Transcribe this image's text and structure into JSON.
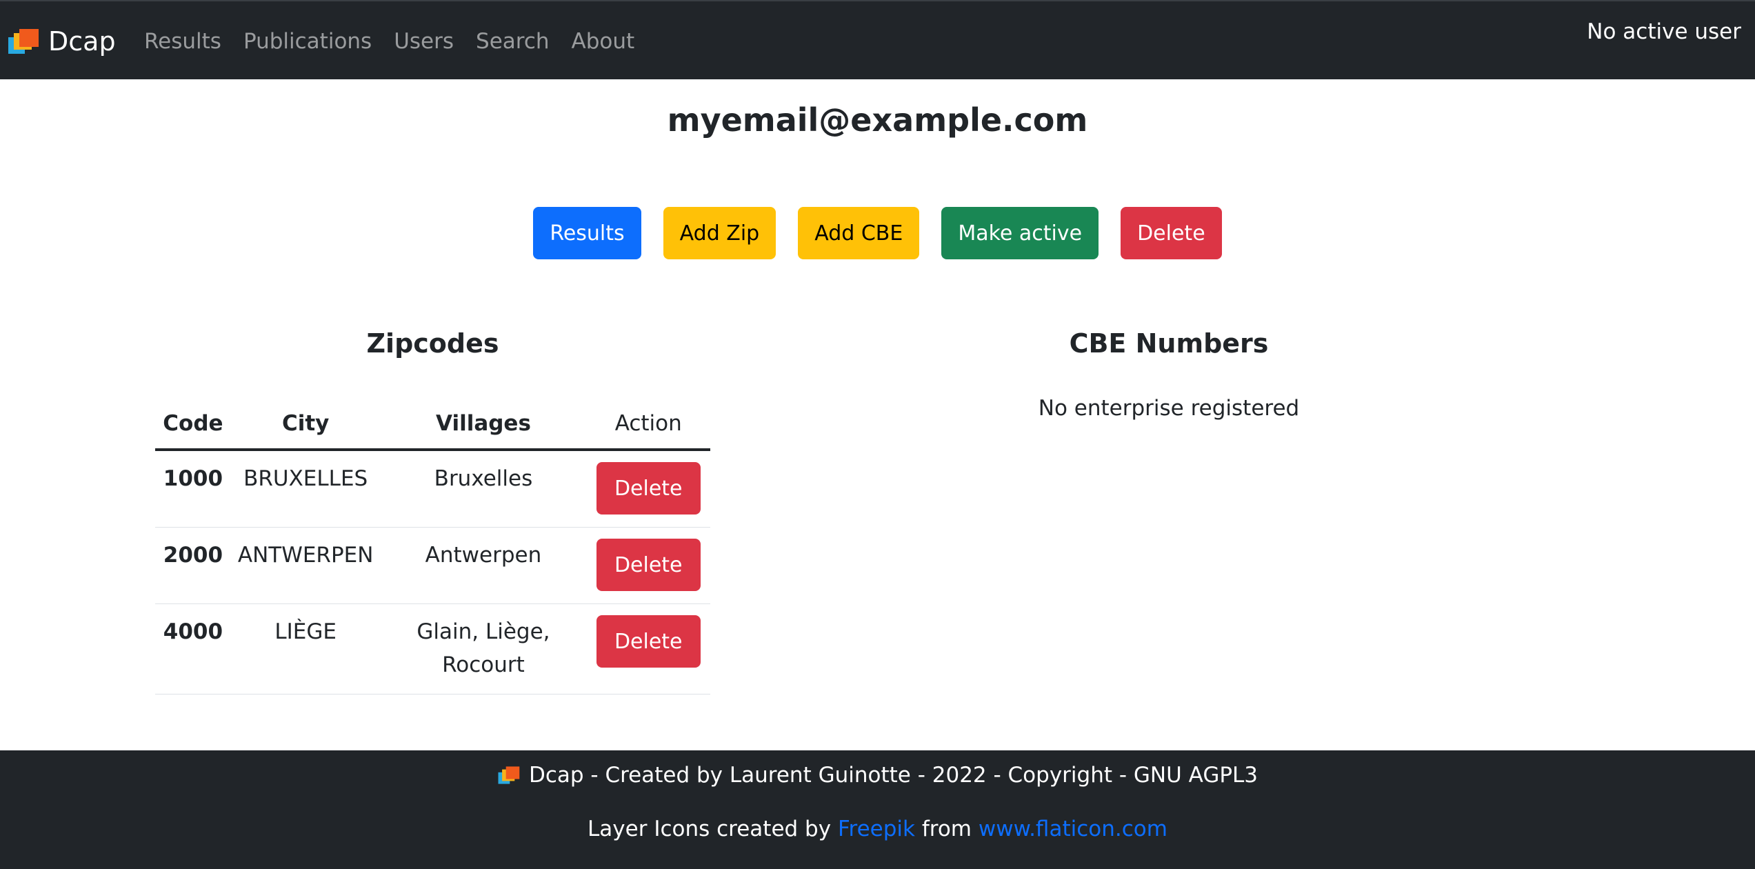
{
  "navbar": {
    "brand": "Dcap",
    "links": [
      "Results",
      "Publications",
      "Users",
      "Search",
      "About"
    ],
    "user_status": "No active user"
  },
  "page": {
    "title": "myemail@example.com"
  },
  "actions": {
    "results": "Results",
    "add_zip": "Add Zip",
    "add_cbe": "Add CBE",
    "make_active": "Make active",
    "delete": "Delete"
  },
  "zipcodes": {
    "title": "Zipcodes",
    "columns": {
      "code": "Code",
      "city": "City",
      "villages": "Villages",
      "action": "Action"
    },
    "rows": [
      {
        "code": "1000",
        "city": "BRUXELLES",
        "villages": "Bruxelles",
        "action": "Delete"
      },
      {
        "code": "2000",
        "city": "ANTWERPEN",
        "villages": "Antwerpen",
        "action": "Delete"
      },
      {
        "code": "4000",
        "city": "LIÈGE",
        "villages": "Glain, Liège, Rocourt",
        "action": "Delete"
      }
    ]
  },
  "cbe": {
    "title": "CBE Numbers",
    "empty_message": "No enterprise registered"
  },
  "footer": {
    "line1": "Dcap - Created by Laurent Guinotte - 2022 - Copyright - GNU AGPL3",
    "credit_prefix": "Layer Icons created by",
    "credit_author": "Freepik",
    "credit_middle": "from",
    "credit_site": "www.flaticon.com"
  },
  "colors": {
    "navbar_bg": "#212529",
    "primary": "#0d6efd",
    "warning": "#ffc107",
    "success": "#198754",
    "danger": "#dc3545"
  }
}
